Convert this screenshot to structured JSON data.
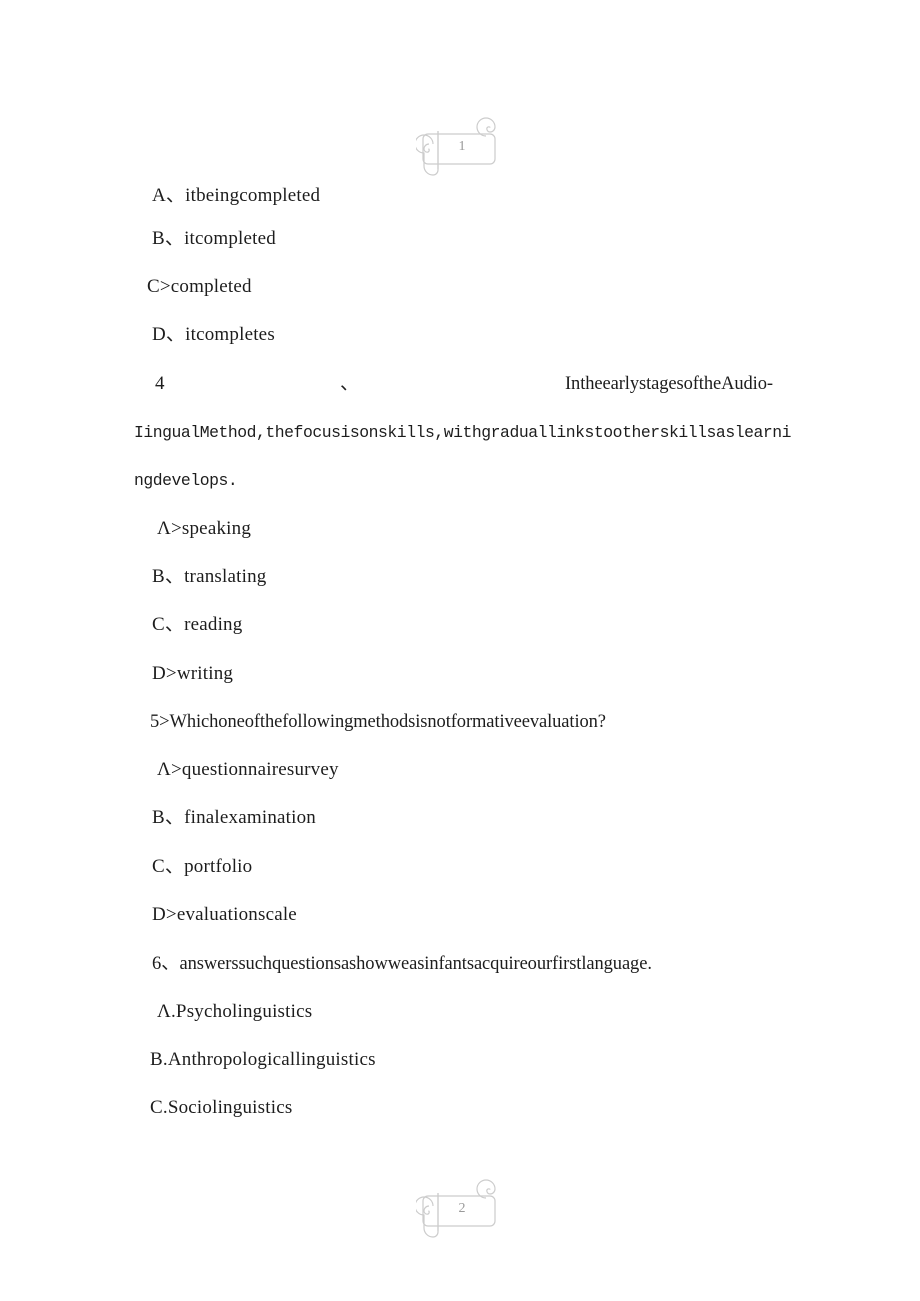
{
  "document": {
    "background_color": "#ffffff",
    "text_color": "#1d1d1a",
    "marker_color": "#c9c9c9",
    "marker_number_color": "#9a9a9a"
  },
  "page_markers": [
    {
      "name": "page-marker-top",
      "number": "1",
      "icon": "scroll-banner-icon"
    },
    {
      "name": "page-marker-bottom",
      "number": "2",
      "icon": "scroll-banner-icon"
    }
  ],
  "content": {
    "lines": [
      {
        "id": "q3-opt-a",
        "text": "A、itbeingcompleted"
      },
      {
        "id": "q3-opt-b",
        "text": "B、itcompleted"
      },
      {
        "id": "q3-opt-c",
        "text": "C>completed"
      },
      {
        "id": "q3-opt-d",
        "text": "D、itcompletes"
      },
      {
        "id": "q4-number",
        "text": "4"
      },
      {
        "id": "q4-mark",
        "text": "、"
      },
      {
        "id": "q4-stem-1",
        "text": "IntheearlystagesoftheAudio-"
      },
      {
        "id": "q4-stem-2",
        "text": "IingualMethod,thefocusisonskills,withgraduallinkstootherskillsaslearni"
      },
      {
        "id": "q4-stem-3",
        "text": "ngdevelops."
      },
      {
        "id": "q4-opt-a",
        "text": "Λ>speaking"
      },
      {
        "id": "q4-opt-b",
        "text": "B、translating"
      },
      {
        "id": "q4-opt-c",
        "text": "C、reading"
      },
      {
        "id": "q4-opt-d",
        "text": "D>writing"
      },
      {
        "id": "q5-stem",
        "text": "5>Whichoneofthefollowingmethodsisnotformativeevaluation?"
      },
      {
        "id": "q5-opt-a",
        "text": "Λ>questionnairesurvey"
      },
      {
        "id": "q5-opt-b",
        "text": "B、finalexamination"
      },
      {
        "id": "q5-opt-c",
        "text": "C、portfolio"
      },
      {
        "id": "q5-opt-d",
        "text": "D>evaluationscale"
      },
      {
        "id": "q6-stem",
        "text": "6、answerssuchquestionsashowweasinfantsacquireourfirstlanguage."
      },
      {
        "id": "q6-opt-a",
        "text": "Λ.Psycholinguistics"
      },
      {
        "id": "q6-opt-b",
        "text": "B.Anthropologicallinguistics"
      },
      {
        "id": "q6-opt-c",
        "text": "C.Sociolinguistics"
      }
    ]
  }
}
